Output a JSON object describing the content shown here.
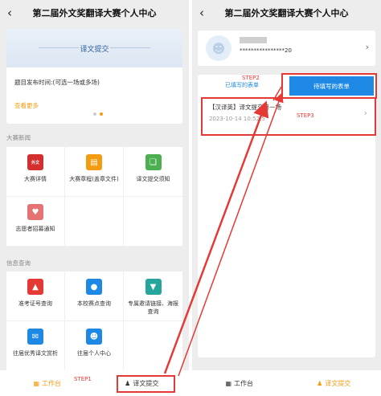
{
  "left": {
    "title": "第二届外文奖翻译大赛个人中心",
    "banner": {
      "title": "译文提交",
      "subtitle": "题目发布时间:(可选一场或多场)",
      "more": "查看更多"
    },
    "news_label": "大赛新闻",
    "news_items": [
      {
        "label": "大赛详情",
        "icon": "news-logo-icon",
        "color": "#d32f2f"
      },
      {
        "label": "大赛章程(盖章文件)",
        "icon": "document-icon",
        "color": "#f39c12"
      },
      {
        "label": "译文提交须知",
        "icon": "book-icon",
        "color": "#4caf50"
      },
      {
        "label": "志愿者招募通知",
        "icon": "heart-icon",
        "color": "#e57373"
      }
    ],
    "info_label": "信息查询",
    "info_items": [
      {
        "label": "准考证号查询",
        "icon": "graduation-cap-icon",
        "color": "#e53935"
      },
      {
        "label": "本校赛点查询",
        "icon": "location-pin-icon",
        "color": "#1e88e5"
      },
      {
        "label": "专属邀请链接、海报查询",
        "icon": "cup-icon",
        "color": "#26a69a"
      },
      {
        "label": "往届优秀译文赏析",
        "icon": "chat-icon",
        "color": "#1e88e5"
      },
      {
        "label": "往届个人中心",
        "icon": "user-icon",
        "color": "#1e88e5"
      }
    ],
    "tabs": {
      "workbench": "工作台",
      "submit": "译文提交"
    },
    "step1": "STEP1"
  },
  "right": {
    "title": "第二届外文奖翻译大赛个人中心",
    "profile": {
      "name": "***** ",
      "phone": "****************20"
    },
    "tab_filled": "已填写的表单",
    "tab_pending": "待填写的表单",
    "entry": {
      "title": "【汉译英】译文提交第一场",
      "date": "2023-10-14 10:52:5"
    },
    "tabs": {
      "workbench": "工作台",
      "submit": "译文提交"
    },
    "step2": "STEP2",
    "step3": "STEP3"
  },
  "colors": {
    "accent": "#f39c12",
    "primary": "#1e88e5",
    "annotation": "#e53935"
  }
}
